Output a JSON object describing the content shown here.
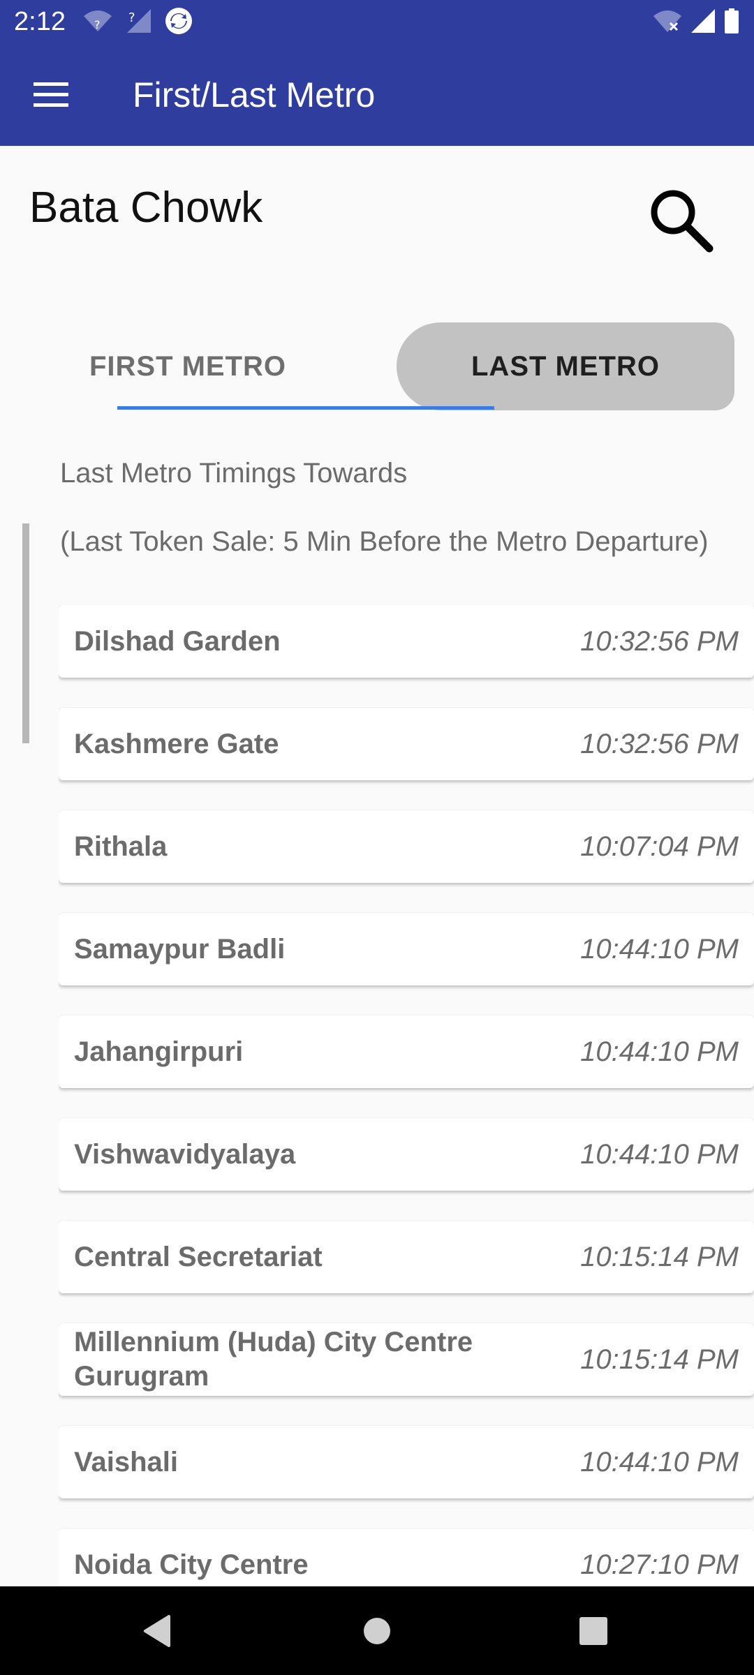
{
  "status_bar": {
    "time": "2:12",
    "icons_left": [
      "wifi-unknown-icon",
      "signal-unknown-icon",
      "sync-icon"
    ],
    "icons_right": [
      "wifi-off-icon",
      "cell-signal-icon",
      "battery-icon"
    ]
  },
  "app_bar": {
    "title": "First/Last Metro",
    "menu_icon": "hamburger-menu-icon"
  },
  "station": {
    "name": "Bata Chowk",
    "search_icon": "search-icon"
  },
  "tabs": [
    {
      "label": "FIRST METRO",
      "selected": false
    },
    {
      "label": "LAST METRO",
      "selected": true
    }
  ],
  "captions": {
    "towards": "Last Metro Timings Towards",
    "token_note": "(Last Token Sale: 5 Min Before the Metro Departure)"
  },
  "timings": [
    {
      "destination": "Dilshad Garden",
      "time": "10:32:56 PM"
    },
    {
      "destination": "Kashmere Gate",
      "time": "10:32:56 PM"
    },
    {
      "destination": "Rithala",
      "time": "10:07:04 PM"
    },
    {
      "destination": "Samaypur Badli",
      "time": "10:44:10 PM"
    },
    {
      "destination": "Jahangirpuri",
      "time": "10:44:10 PM"
    },
    {
      "destination": "Vishwavidyalaya",
      "time": "10:44:10 PM"
    },
    {
      "destination": "Central Secretariat",
      "time": "10:15:14 PM"
    },
    {
      "destination": "Millennium (Huda) City Centre Gurugram",
      "time": "10:15:14 PM"
    },
    {
      "destination": "Vaishali",
      "time": "10:44:10 PM"
    },
    {
      "destination": "Noida City Centre",
      "time": "10:27:10 PM"
    }
  ],
  "nav_bar": {
    "back_icon": "back-triangle-icon",
    "home_icon": "home-circle-icon",
    "recents_icon": "recents-square-icon"
  },
  "colors": {
    "primary": "#2f3e9e",
    "tab_indicator": "#3d7be4",
    "selected_tab_bg": "#c2c2c2",
    "background": "#fafafa"
  }
}
